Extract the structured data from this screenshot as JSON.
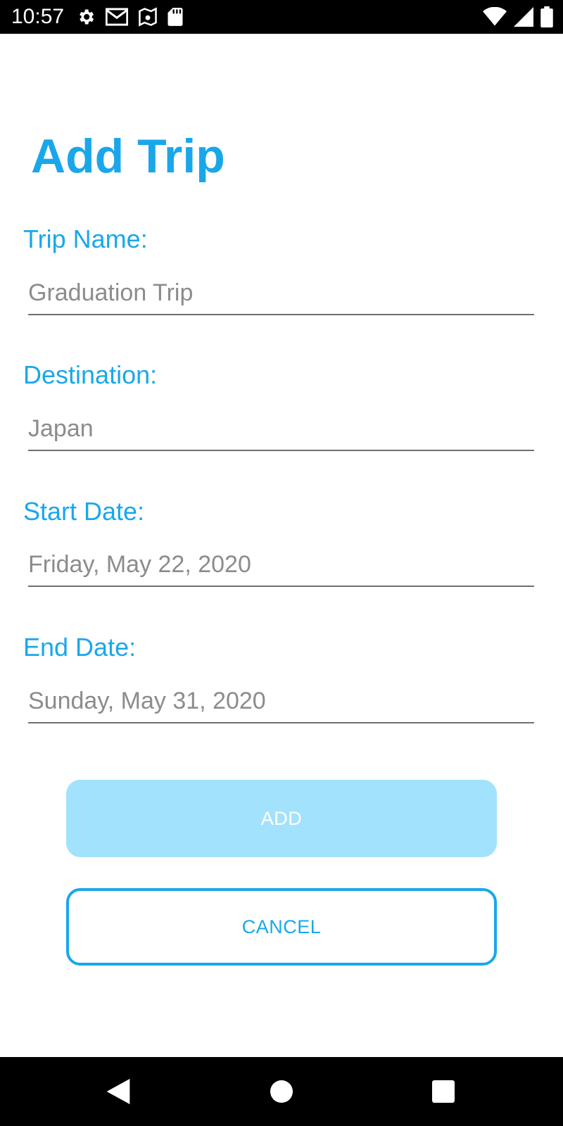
{
  "status_bar": {
    "time": "10:57",
    "left_icons": [
      "gear-icon",
      "gmail-icon",
      "maps-icon",
      "sd-card-icon"
    ],
    "right_icons": [
      "wifi-icon",
      "signal-icon",
      "battery-icon"
    ]
  },
  "page": {
    "title": "Add Trip"
  },
  "form": {
    "trip_name": {
      "label": "Trip Name:",
      "value": "Graduation Trip"
    },
    "destination": {
      "label": "Destination:",
      "value": "Japan"
    },
    "start_date": {
      "label": "Start Date:",
      "value": "Friday, May 22, 2020"
    },
    "end_date": {
      "label": "End Date:",
      "value": "Sunday, May 31, 2020"
    }
  },
  "buttons": {
    "add_label": "ADD",
    "cancel_label": "CANCEL"
  },
  "nav_bar": {
    "icons": [
      "back-icon",
      "home-icon",
      "recents-icon"
    ]
  },
  "colors": {
    "accent": "#1aa7ea",
    "add_button_disabled": "#a3e2fc",
    "input_text": "#8c8c8c"
  }
}
